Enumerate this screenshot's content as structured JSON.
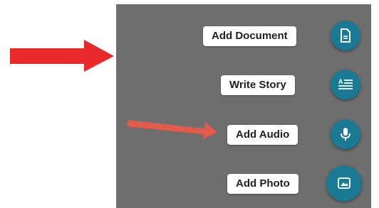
{
  "menu": {
    "items": [
      {
        "label": "Add Document",
        "icon": "document-icon"
      },
      {
        "label": "Write Story",
        "icon": "story-icon"
      },
      {
        "label": "Add Audio",
        "icon": "microphone-icon"
      },
      {
        "label": "Add Photo",
        "icon": "photo-icon"
      }
    ]
  },
  "colors": {
    "panel": "#6e6e6e",
    "fab": "#1a7a93",
    "annotation_arrow": "#e83a2e"
  }
}
